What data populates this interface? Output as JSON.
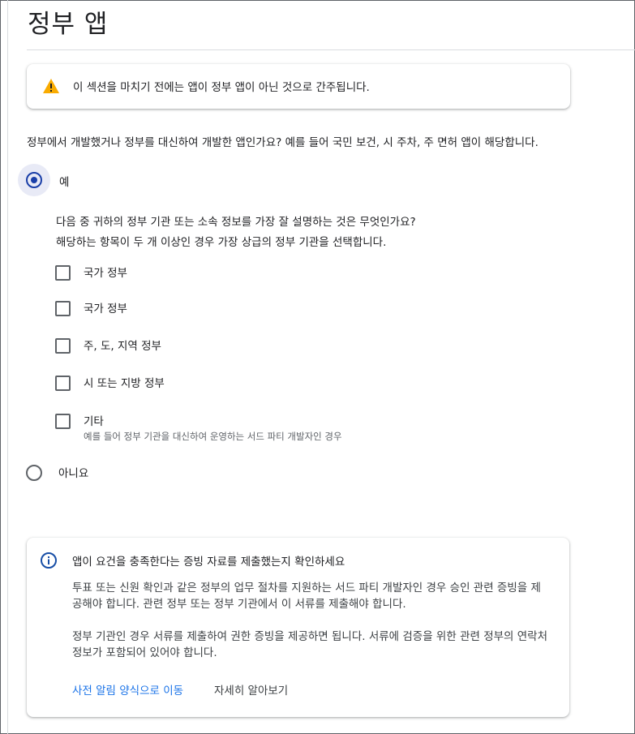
{
  "page": {
    "title": "정부 앱"
  },
  "warning": {
    "icon": "warning-icon",
    "text": "이 섹션을 마치기 전에는 앱이 정부 앱이 아닌 것으로 간주됩니다.",
    "color": "#f9ab00"
  },
  "question": {
    "text": "정부에서 개발했거나 정부를 대신하여 개발한 앱인가요? 예를 들어 국민 보건, 시 주차, 주 면허 앱이 해당합니다.",
    "options": {
      "yes": "예",
      "no": "아니요"
    },
    "selected": "yes"
  },
  "sub_question": {
    "line1": "다음 중 귀하의 정부 기관 또는 소속 정보를 가장 잘 설명하는 것은 무엇인가요?",
    "line2": "해당하는 항목이 두 개 이상인 경우 가장 상급의 정부 기관을 선택합니다.",
    "checkboxes": [
      {
        "label": "국가 정부",
        "checked": false
      },
      {
        "label": "국가 정부",
        "checked": false
      },
      {
        "label": "주, 도, 지역 정부",
        "checked": false
      },
      {
        "label": "시 또는 지방 정부",
        "checked": false
      },
      {
        "label": "기타",
        "description": "예를 들어 정부 기관을 대신하여 운영하는 서드 파티 개발자인 경우",
        "checked": false
      }
    ]
  },
  "info": {
    "icon": "info-icon",
    "title": "앱이 요건을 충족한다는 증빙 자료를 제출했는지 확인하세요",
    "paragraph1": "투표 또는 신원 확인과 같은 정부의 업무 절차를 지원하는 서드 파티 개발자인 경우 승인 관련 증빙을 제공해야 합니다. 관련 정부 또는 정부 기관에서 이 서류를 제출해야 합니다.",
    "paragraph2": "정부 기관인 경우 서류를 제출하여 권한 증빙을 제공하면 됩니다. 서류에 검증을 위한 관련 정부의 연락처 정보가 포함되어 있어야 합니다.",
    "link_primary": "사전 알림 양식으로 이동",
    "link_secondary": "자세히 알아보기",
    "color": "#174ea6"
  },
  "colors": {
    "accent": "#1a73e8",
    "radio_selected": "#1a3fa8"
  }
}
